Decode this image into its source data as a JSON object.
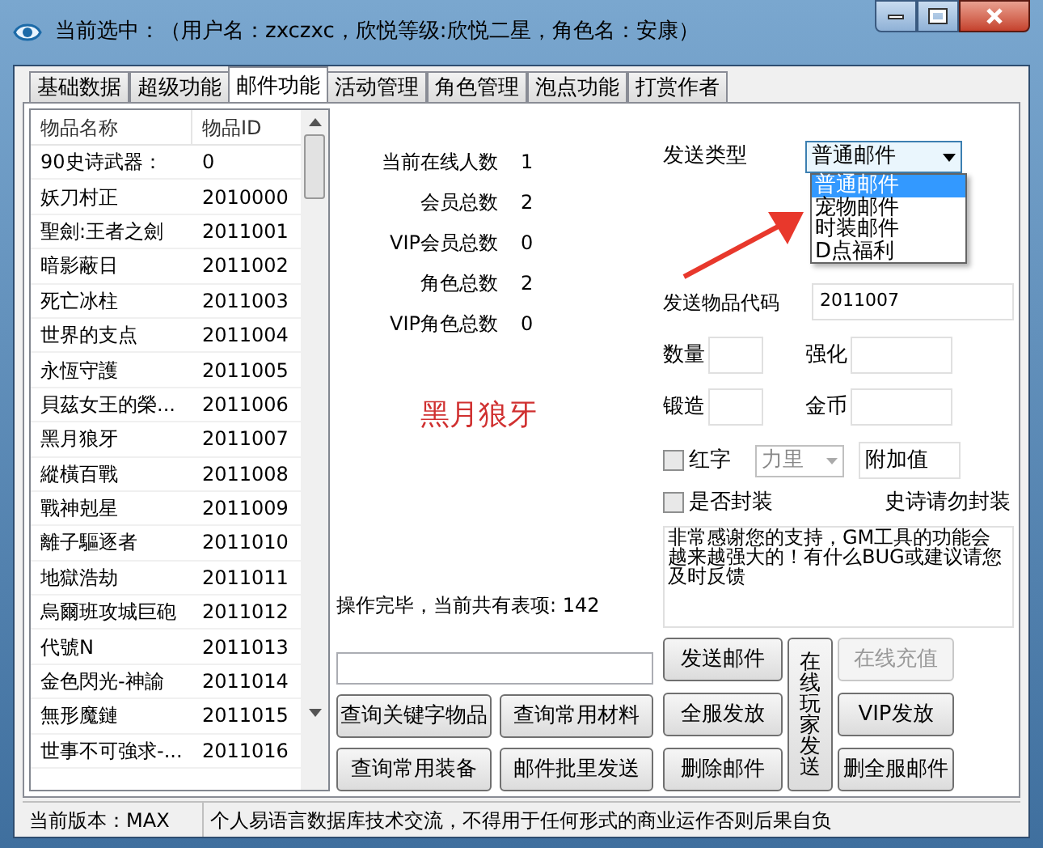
{
  "window": {
    "title": "当前选中：（用户名：zxczxc，欣悦等级:欣悦二星，角色名：安康）"
  },
  "tabs": [
    {
      "label": "基础数据",
      "selected": false
    },
    {
      "label": "超级功能",
      "selected": false
    },
    {
      "label": "邮件功能",
      "selected": true
    },
    {
      "label": "活动管理",
      "selected": false
    },
    {
      "label": "角色管理",
      "selected": false
    },
    {
      "label": "泡点功能",
      "selected": false
    },
    {
      "label": "打赏作者",
      "selected": false
    }
  ],
  "item_table": {
    "columns": [
      "物品名称",
      "物品ID"
    ],
    "rows": [
      [
        "90史诗武器：",
        "0"
      ],
      [
        "妖刀村正",
        "2010000"
      ],
      [
        "聖劍:王者之劍",
        "2011001"
      ],
      [
        "暗影蔽日",
        "2011002"
      ],
      [
        "死亡冰柱",
        "2011003"
      ],
      [
        "世界的支点",
        "2011004"
      ],
      [
        "永恆守護",
        "2011005"
      ],
      [
        "貝茲女王的榮...",
        "2011006"
      ],
      [
        "黑月狼牙",
        "2011007"
      ],
      [
        "縱橫百戰",
        "2011008"
      ],
      [
        "戰神剋星",
        "2011009"
      ],
      [
        "離子驅逐者",
        "2011010"
      ],
      [
        "地獄浩劫",
        "2011011"
      ],
      [
        "烏爾班攻城巨砲",
        "2011012"
      ],
      [
        "代號N",
        "2011013"
      ],
      [
        "金色閃光-神諭",
        "2011014"
      ],
      [
        "無形魔鏈",
        "2011015"
      ],
      [
        "世事不可強求-...",
        "2011016"
      ]
    ]
  },
  "stats": [
    {
      "label": "当前在线人数",
      "value": "1"
    },
    {
      "label": "会员总数",
      "value": "2"
    },
    {
      "label": "VIP会员总数",
      "value": "0"
    },
    {
      "label": "角色总数",
      "value": "2"
    },
    {
      "label": "VIP角色总数",
      "value": "0"
    }
  ],
  "selected_item_name": "黑月狼牙",
  "status_message": "操作完毕，当前共有表项: 142",
  "send_type": {
    "label": "发送类型",
    "value": "普通邮件",
    "expanded": true,
    "options": [
      {
        "label": "普通邮件",
        "selected": true
      },
      {
        "label": "宠物邮件",
        "selected": false
      },
      {
        "label": "时装邮件",
        "selected": false
      },
      {
        "label": "D点福利",
        "selected": false
      }
    ]
  },
  "item_code": {
    "label": "发送物品代码",
    "value": "2011007"
  },
  "fields": [
    {
      "label": "数量"
    },
    {
      "label": "强化"
    },
    {
      "label": "锻造"
    },
    {
      "label": "金币"
    }
  ],
  "red_text": {
    "label": "红字",
    "checked": false
  },
  "attribute": {
    "value": "力里",
    "disabled": true
  },
  "bonus": {
    "value": "附加值"
  },
  "sealed": {
    "label": "是否封装",
    "checked": false
  },
  "seal_note": "史诗请勿封装",
  "message": "非常感谢您的支持，GM工具的功能会越来越强大的！有什么BUG或建议请您及时反馈",
  "query_buttons": [
    {
      "label": "查询关键字物品"
    },
    {
      "label": "查询常用材料"
    },
    {
      "label": "查询常用装备"
    },
    {
      "label": "邮件批里发送"
    }
  ],
  "mail_buttons": [
    {
      "label": "发送邮件",
      "disabled": false
    },
    {
      "label": "全服发放",
      "disabled": false
    },
    {
      "label": "删除邮件",
      "disabled": false
    }
  ],
  "online_send_button": {
    "label": "在线玩家发送"
  },
  "side_buttons": [
    {
      "label": "在线充值",
      "disabled": true
    },
    {
      "label": "VIP发放",
      "disabled": false
    },
    {
      "label": "删全服邮件",
      "disabled": false
    }
  ],
  "status_bar": [
    "当前版本：MAX",
    "个人易语言数据库技术交流，不得用于任何形式的商业运作否则后果自负"
  ]
}
